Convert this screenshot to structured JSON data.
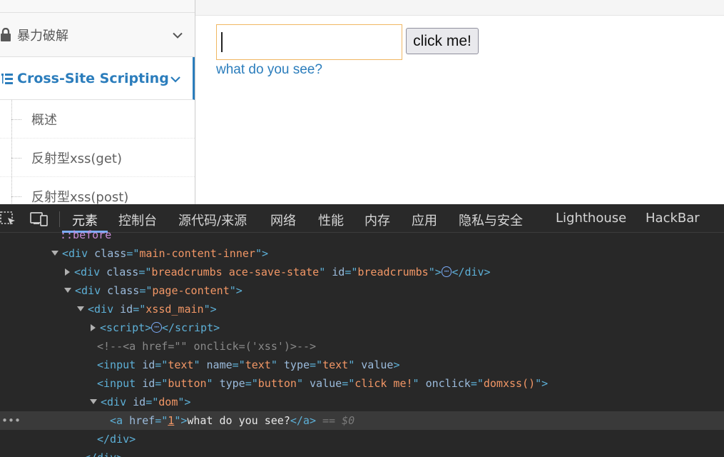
{
  "sidebar": {
    "brute_force": "暴力破解",
    "xss": "Cross-Site Scripting",
    "sub_items": [
      "概述",
      "反射型xss(get)",
      "反射型xss(post)"
    ]
  },
  "main": {
    "input_value": "",
    "button_label": "click me!",
    "link_text": "what do you see?"
  },
  "devtools": {
    "tabs": [
      "元素",
      "控制台",
      "源代码/来源",
      "网络",
      "性能",
      "内存",
      "应用",
      "隐私与安全",
      "Lighthouse",
      "HackBar"
    ],
    "active_tab": "元素",
    "pseudo": "::before",
    "lines": {
      "l1_attr": "class",
      "l1_val": "main-content-inner",
      "l2_attr": "class",
      "l2_val": "breadcrumbs ace-save-state",
      "l2_attr2": "id",
      "l2_val2": "breadcrumbs",
      "l3_attr": "class",
      "l3_val": "page-content",
      "l4_attr": "id",
      "l4_val": "xssd_main",
      "l5_tag": "script",
      "l6_comment": "<!--<a href=\"\" onclick=('xss')>-->",
      "l7_id": "text",
      "l7_name": "text",
      "l7_type": "text",
      "l7_value": "value",
      "l8_id": "button",
      "l8_type": "button",
      "l8_value": "click me!",
      "l8_onclick": "domxss()",
      "l9_id": "dom",
      "l10_href": "1",
      "l10_text": "what do you see?",
      "l10_marker": "== $0"
    },
    "ellipsis": "⋯"
  },
  "colors": {
    "accent": "#2b7dbc",
    "devtools_bg": "#282828",
    "tag": "#5db0d7",
    "attr_value": "#f29766"
  }
}
